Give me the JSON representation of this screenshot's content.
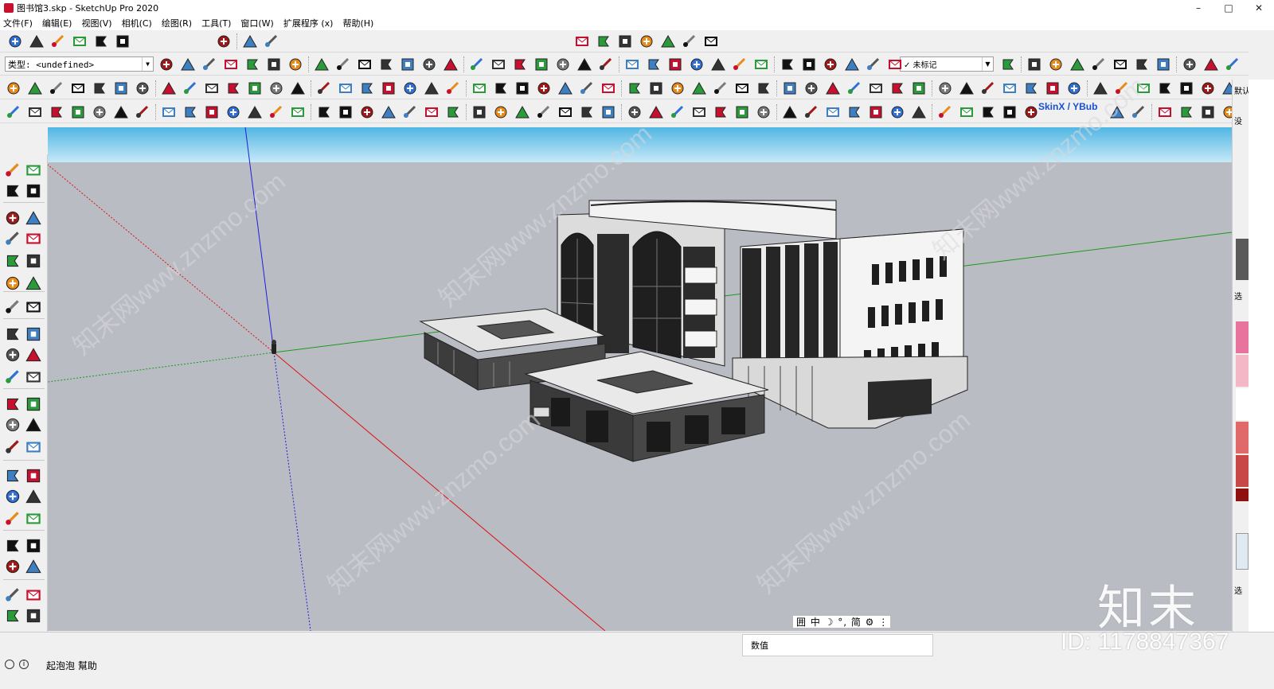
{
  "window": {
    "title": "图书馆3.skp - SketchUp Pro 2020",
    "controls": [
      "–",
      "□",
      "✕"
    ]
  },
  "menubar": {
    "items": [
      "文件(F)",
      "编辑(E)",
      "视图(V)",
      "相机(C)",
      "绘图(R)",
      "工具(T)",
      "窗口(W)",
      "扩展程序 (x)",
      "帮助(H)"
    ]
  },
  "toolbar": {
    "tag_select_value": "类型: <undefined>",
    "layer_select_value": "✓ 未标记",
    "skin_label": "SkinX / YBub"
  },
  "status": {
    "text": "起泡泡 幫助",
    "measurements_label": "数值",
    "ime_text": "囲 中 ☽ °, 简 ⚙ ⋮"
  },
  "right_panel": {
    "label_1": "默认",
    "label_2": "没",
    "label_3": "选",
    "label_4": "选"
  },
  "watermark": {
    "brand": "知末",
    "id_text": "ID: 1178847367",
    "site_text": "知末网www.znzmo.com"
  },
  "colors": {
    "sky_top": "#52b6e3",
    "sky_bottom": "#bfe6f6",
    "ground": "#babcc4",
    "axis_red": "#d11",
    "axis_green": "#1a9a1a",
    "axis_blue": "#1f1fd6"
  }
}
